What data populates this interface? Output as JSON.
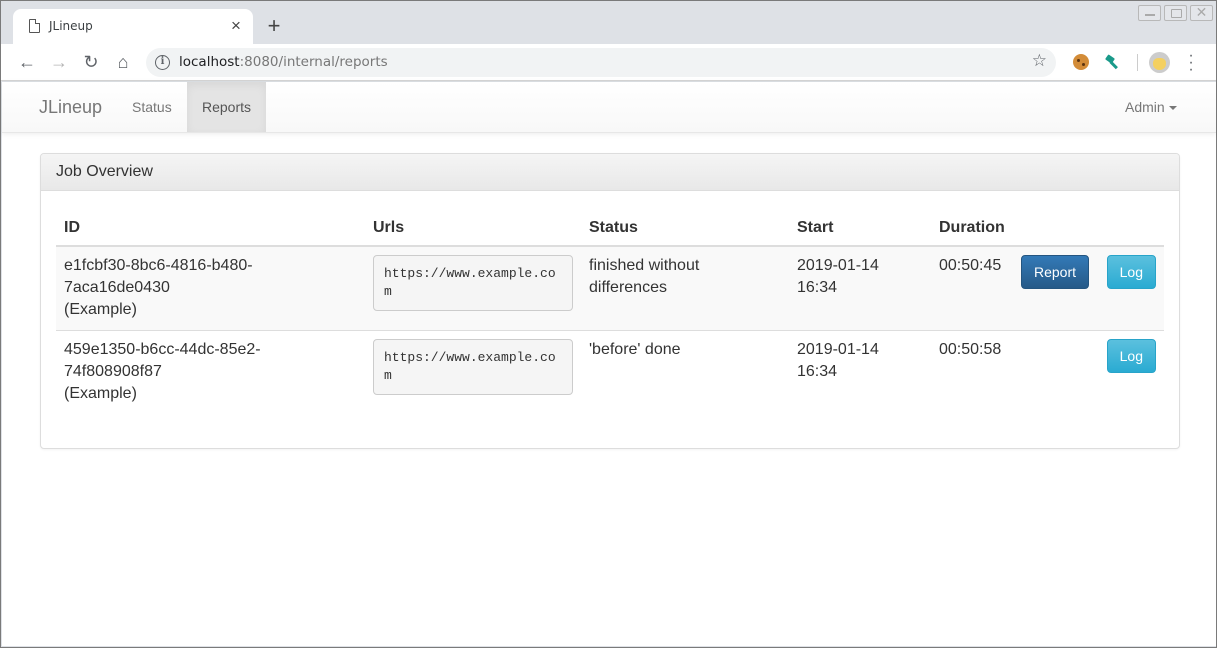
{
  "browser": {
    "tab_title": "JLineup",
    "url_host": "localhost",
    "url_rest": ":8080/internal/reports",
    "icons": [
      "file-icon",
      "close-icon",
      "plus-icon",
      "back-icon",
      "forward-icon",
      "reload-icon",
      "home-icon",
      "info-icon",
      "star-icon",
      "cookie-extension-icon",
      "key-extension-icon",
      "avatar",
      "more-vert-icon"
    ]
  },
  "navbar": {
    "brand": "JLineup",
    "links": [
      {
        "label": "Status",
        "active": false
      },
      {
        "label": "Reports",
        "active": true
      }
    ],
    "admin_label": "Admin"
  },
  "panel": {
    "title": "Job Overview",
    "columns": [
      "ID",
      "Urls",
      "Status",
      "Start",
      "Duration"
    ],
    "rows": [
      {
        "id_line1": "e1fcbf30-8bc6-4816-b480-",
        "id_line2": "7aca16de0430",
        "id_name": "(Example)",
        "url": "https://www.example.com",
        "status": "finished without differences",
        "start_date": "2019-01-14",
        "start_time": "16:34",
        "duration": "00:50:45",
        "report_label": "Report",
        "log_label": "Log"
      },
      {
        "id_line1": "459e1350-b6cc-44dc-85e2-",
        "id_line2": "74f808908f87",
        "id_name": "(Example)",
        "url": "https://www.example.com",
        "status": "'before' done",
        "start_date": "2019-01-14",
        "start_time": "16:34",
        "duration": "00:50:58",
        "log_label": "Log"
      }
    ]
  },
  "colors": {
    "primary": "#286090",
    "info": "#31b0d5"
  }
}
